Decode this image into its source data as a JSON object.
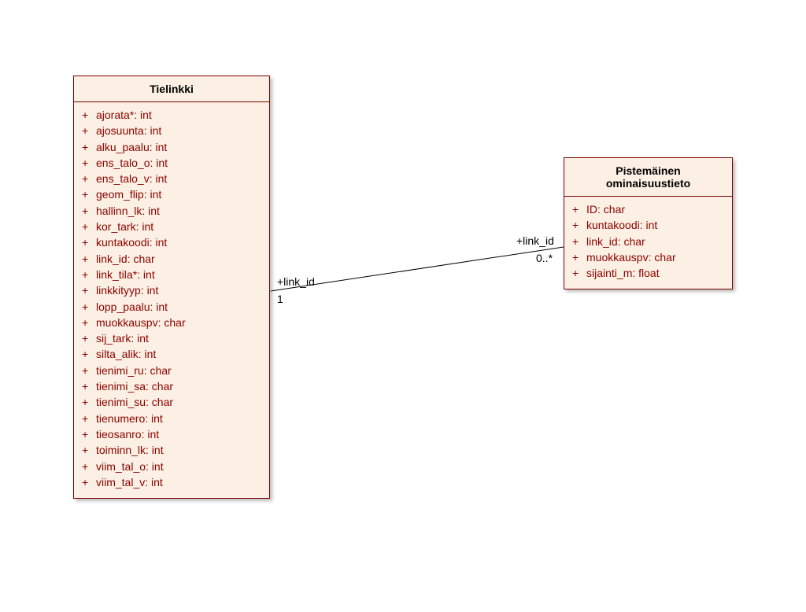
{
  "diagram": {
    "class_left": {
      "title": "Tielinkki",
      "attrs": [
        "ajorata*: int",
        "ajosuunta: int",
        "alku_paalu: int",
        "ens_talo_o: int",
        "ens_talo_v: int",
        "geom_flip: int",
        "hallinn_lk: int",
        "kor_tark: int",
        "kuntakoodi: int",
        "link_id: char",
        "link_tila*: int",
        "linkkityyp: int",
        "lopp_paalu: int",
        "muokkauspv: char",
        "sij_tark: int",
        "silta_alik: int",
        "tienimi_ru: char",
        "tienimi_sa: char",
        "tienimi_su: char",
        "tienumero: int",
        "tieosanro: int",
        "toiminn_lk: int",
        "viim_tal_o: int",
        "viim_tal_v: int"
      ]
    },
    "class_right": {
      "title": "Pistemäinen\nominaisuustieto",
      "attrs": [
        "ID: char",
        "kuntakoodi: int",
        "link_id: char",
        "muokkauspv: char",
        "sijainti_m: float"
      ]
    },
    "assoc": {
      "left_role": "+link_id",
      "left_mult": "1",
      "right_role": "+link_id",
      "right_mult": "0..*"
    }
  }
}
